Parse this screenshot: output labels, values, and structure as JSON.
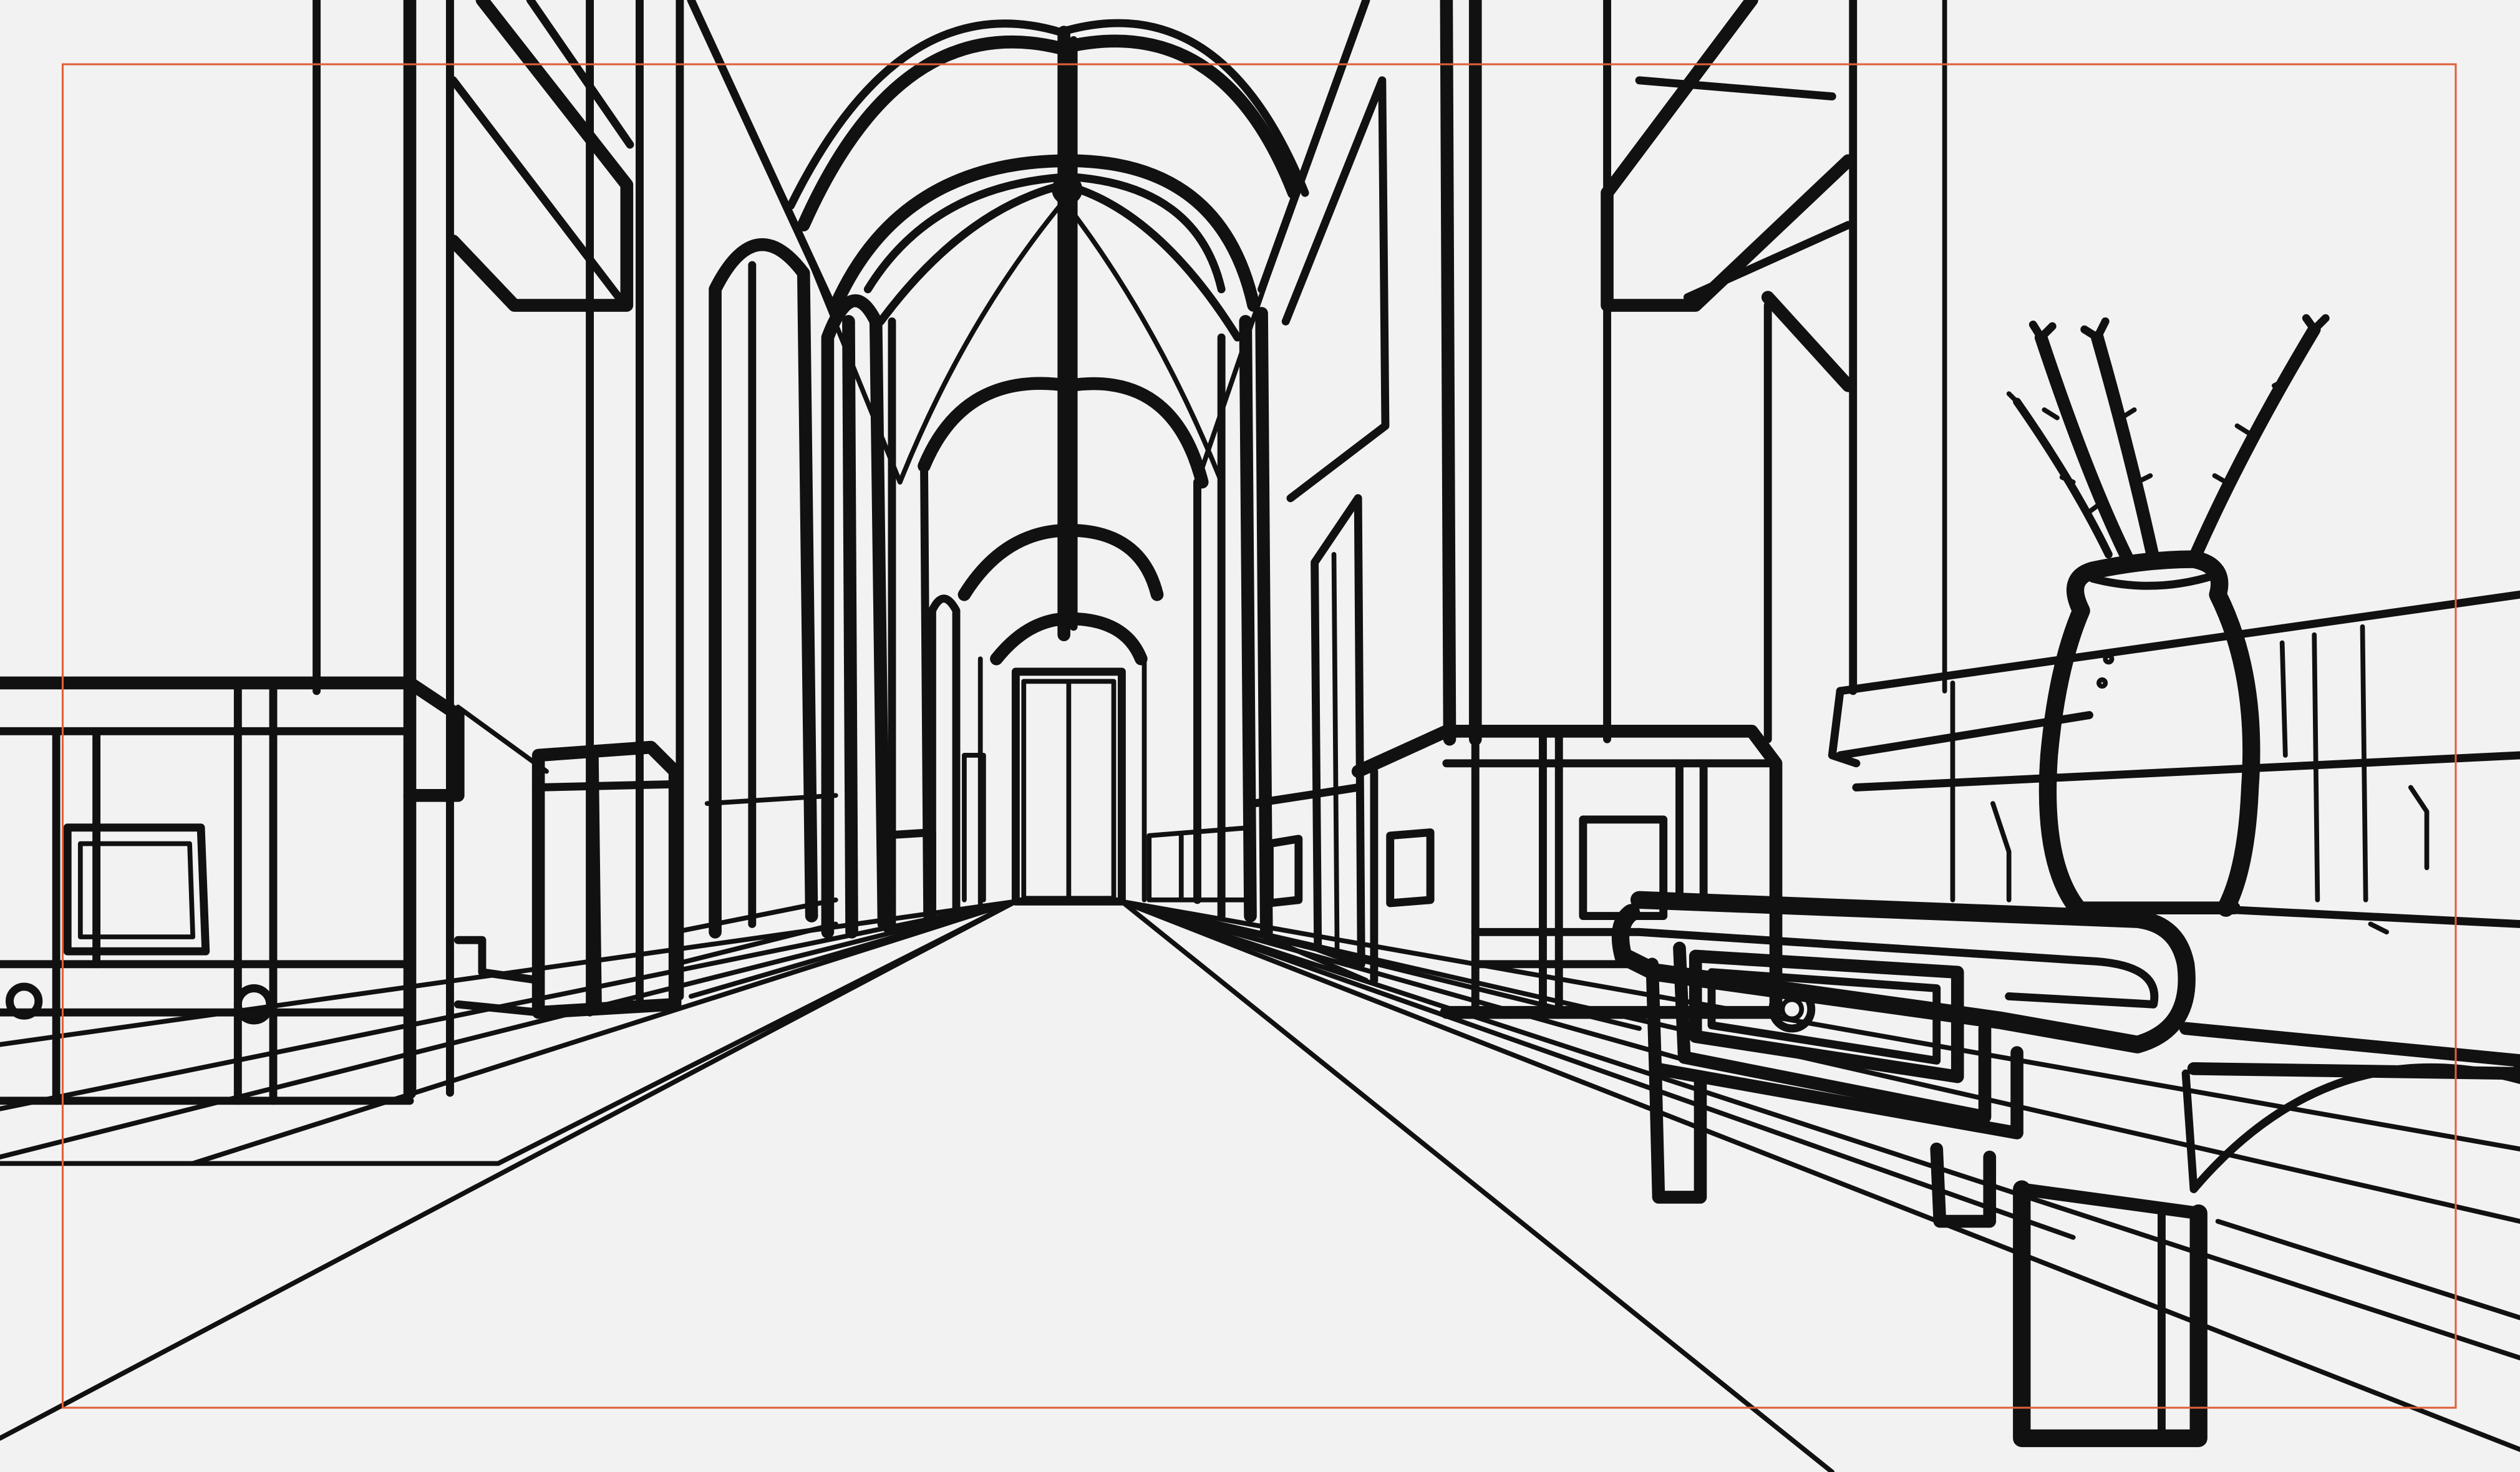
{
  "canvas": {
    "background": "#f2f2f2",
    "line_color": "#111111",
    "frame_color": "#e0603a"
  },
  "scene": {
    "subject": "sketch-linework",
    "elements": [
      "frame-guide",
      "vaulted-ceiling",
      "far-door",
      "left-pillars",
      "right-pillars",
      "wall-panels",
      "floor-perspective-lines",
      "bench",
      "vase",
      "branches"
    ]
  }
}
